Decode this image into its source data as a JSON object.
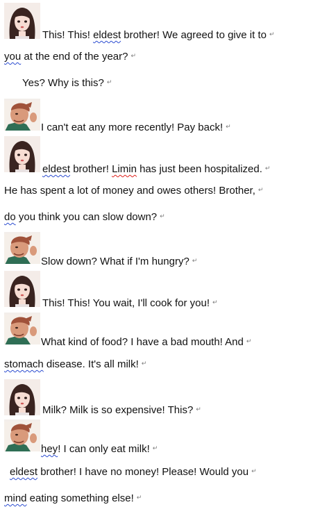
{
  "document": {
    "return_mark": "↵",
    "lines": [
      {
        "parts": [
          {
            "text": "This! This! "
          },
          {
            "text": "eldest",
            "style": "blue"
          },
          {
            "text": " brother! We agreed to give it to"
          }
        ]
      },
      {
        "parts": [
          {
            "text": "you",
            "style": "blue"
          },
          {
            "text": " at the end of the year?"
          }
        ]
      },
      {
        "parts": [
          {
            "text": "Yes? Why is this?"
          }
        ]
      },
      {
        "parts": [
          {
            "text": "I can't eat any more recently! Pay back!"
          }
        ]
      },
      {
        "parts": [
          {
            "text": "eldest",
            "style": "blue"
          },
          {
            "text": " brother! "
          },
          {
            "text": "Limin",
            "style": "red"
          },
          {
            "text": " has just been hospitalized."
          }
        ]
      },
      {
        "parts": [
          {
            "text": "He has spent a lot of money and owes others! Brother,"
          }
        ]
      },
      {
        "parts": [
          {
            "text": "do",
            "style": "blue"
          },
          {
            "text": " you think you can slow down?"
          }
        ]
      },
      {
        "parts": [
          {
            "text": "Slow down? What if I'm hungry?"
          }
        ]
      },
      {
        "parts": [
          {
            "text": "This! This! You wait, I'll cook for you!"
          }
        ]
      },
      {
        "parts": [
          {
            "text": "What kind of food? I have a bad mouth! And"
          }
        ]
      },
      {
        "parts": [
          {
            "text": "stomach",
            "style": "blue"
          },
          {
            "text": " disease. It's all milk!"
          }
        ]
      },
      {
        "parts": [
          {
            "text": "Milk? Milk is so expensive! This?"
          }
        ]
      },
      {
        "parts": [
          {
            "text": "hey",
            "style": "blue"
          },
          {
            "text": "! I can only eat milk!"
          }
        ]
      },
      {
        "parts": [
          {
            "text": "eldest",
            "style": "blue"
          },
          {
            "text": " brother! I have no money! Please! Would you"
          }
        ]
      },
      {
        "parts": [
          {
            "text": "mind",
            "style": "blue"
          },
          {
            "text": " eating something else!"
          }
        ]
      }
    ]
  }
}
